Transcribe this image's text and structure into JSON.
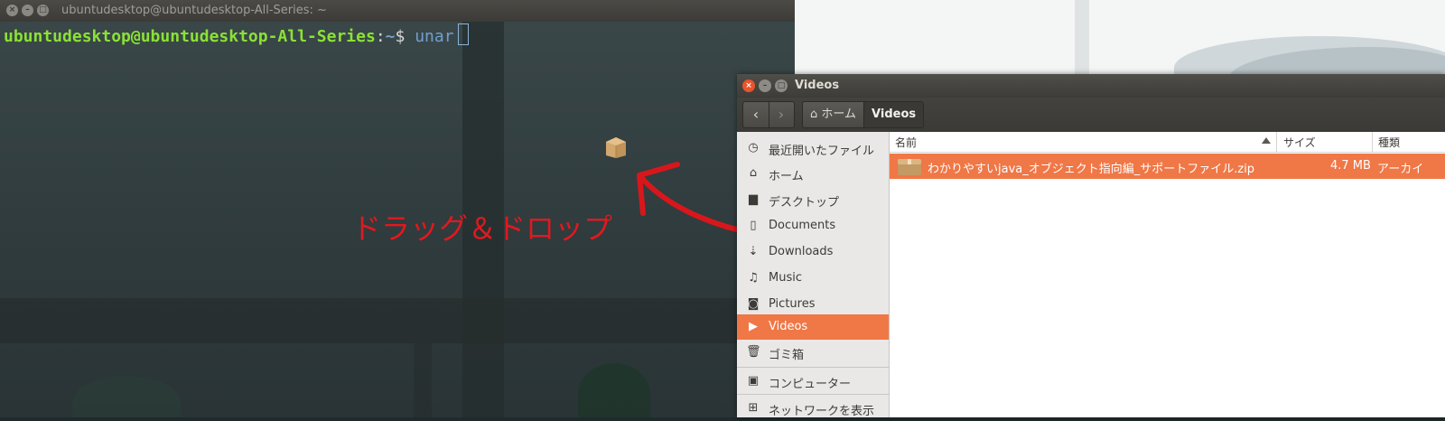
{
  "terminal": {
    "title": "ubuntudesktop@ubuntudesktop-All-Series: ~",
    "prompt_user": "ubuntudesktop@ubuntudesktop-All-Series",
    "prompt_colon": ":",
    "prompt_path": "~",
    "prompt_dollar": "$",
    "command": "unar"
  },
  "annotation": {
    "text": "ドラッグ＆ドロップ",
    "color": "#e0191e"
  },
  "file_manager": {
    "title": "Videos",
    "nav": {
      "back_icon": "chevron-left-icon",
      "forward_icon": "chevron-right-icon"
    },
    "breadcrumbs": [
      {
        "label": "ホーム",
        "icon": "home-icon"
      },
      {
        "label": "Videos"
      }
    ],
    "sidebar": [
      {
        "label": "最近開いたファイル",
        "icon": "clock-icon"
      },
      {
        "label": "ホーム",
        "icon": "home-icon"
      },
      {
        "label": "デスクトップ",
        "icon": "folder-icon"
      },
      {
        "label": "Documents",
        "icon": "document-icon"
      },
      {
        "label": "Downloads",
        "icon": "download-icon"
      },
      {
        "label": "Music",
        "icon": "music-icon"
      },
      {
        "label": "Pictures",
        "icon": "camera-icon"
      },
      {
        "label": "Videos",
        "icon": "video-icon",
        "active": true
      },
      {
        "label": "ゴミ箱",
        "icon": "trash-icon"
      },
      {
        "label": "コンピューター",
        "icon": "computer-icon"
      },
      {
        "label": "ネットワークを表示",
        "icon": "network-icon"
      }
    ],
    "columns": {
      "name": "名前",
      "size": "サイズ",
      "type": "種類"
    },
    "files": [
      {
        "name": "わかりやすいjava_オブジェクト指向編_サポートファイル.zip",
        "size": "4.7 MB",
        "type": "アーカイ",
        "selected": true
      }
    ],
    "accent": "#f07746"
  }
}
